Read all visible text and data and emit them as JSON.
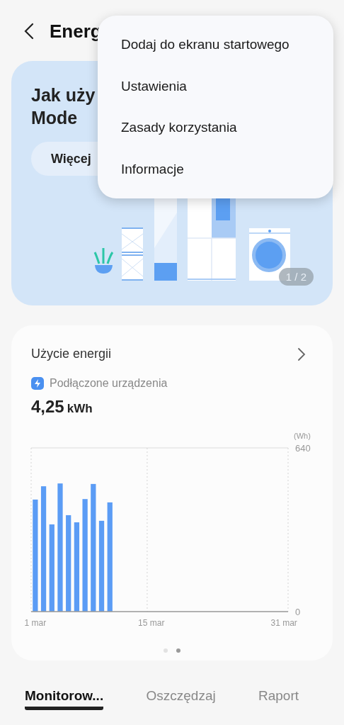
{
  "header": {
    "title": "Energ"
  },
  "menu": {
    "items": [
      {
        "label": "Dodaj do ekranu startowego"
      },
      {
        "label": "Ustawienia"
      },
      {
        "label": "Zasady korzystania"
      },
      {
        "label": "Informacje"
      }
    ]
  },
  "banner": {
    "title_lines": [
      "Jak uży",
      "Mode"
    ],
    "button": "Więcej",
    "page_indicator": "1 / 2"
  },
  "energy_card": {
    "title": "Użycie energii",
    "source": "Podłączone urządzenia",
    "value": "4,25",
    "unit": "kWh",
    "chart_data": {
      "type": "bar",
      "ylabel": "(Wh)",
      "categories": [
        "1 mar",
        null,
        null,
        null,
        null,
        null,
        null,
        null,
        null,
        null,
        null,
        null,
        null,
        null,
        "15 mar",
        null,
        null,
        null,
        null,
        null,
        null,
        null,
        null,
        null,
        null,
        null,
        null,
        null,
        null,
        null,
        "31 mar"
      ],
      "values": [
        438,
        490,
        341,
        501,
        377,
        349,
        440,
        499,
        355,
        427,
        null,
        null,
        null,
        null,
        null,
        null,
        null,
        null,
        null,
        null,
        null,
        null,
        null,
        null,
        null,
        null,
        null,
        null,
        null,
        null,
        null
      ],
      "ylim": [
        0,
        640
      ],
      "yticks": [
        0,
        640
      ]
    },
    "pages": [
      {
        "selected": false
      },
      {
        "selected": true
      }
    ]
  },
  "tabs": [
    {
      "label": "Monitorow...",
      "selected": true
    },
    {
      "label": "Oszczędzaj",
      "selected": false
    },
    {
      "label": "Raport",
      "selected": false
    }
  ]
}
